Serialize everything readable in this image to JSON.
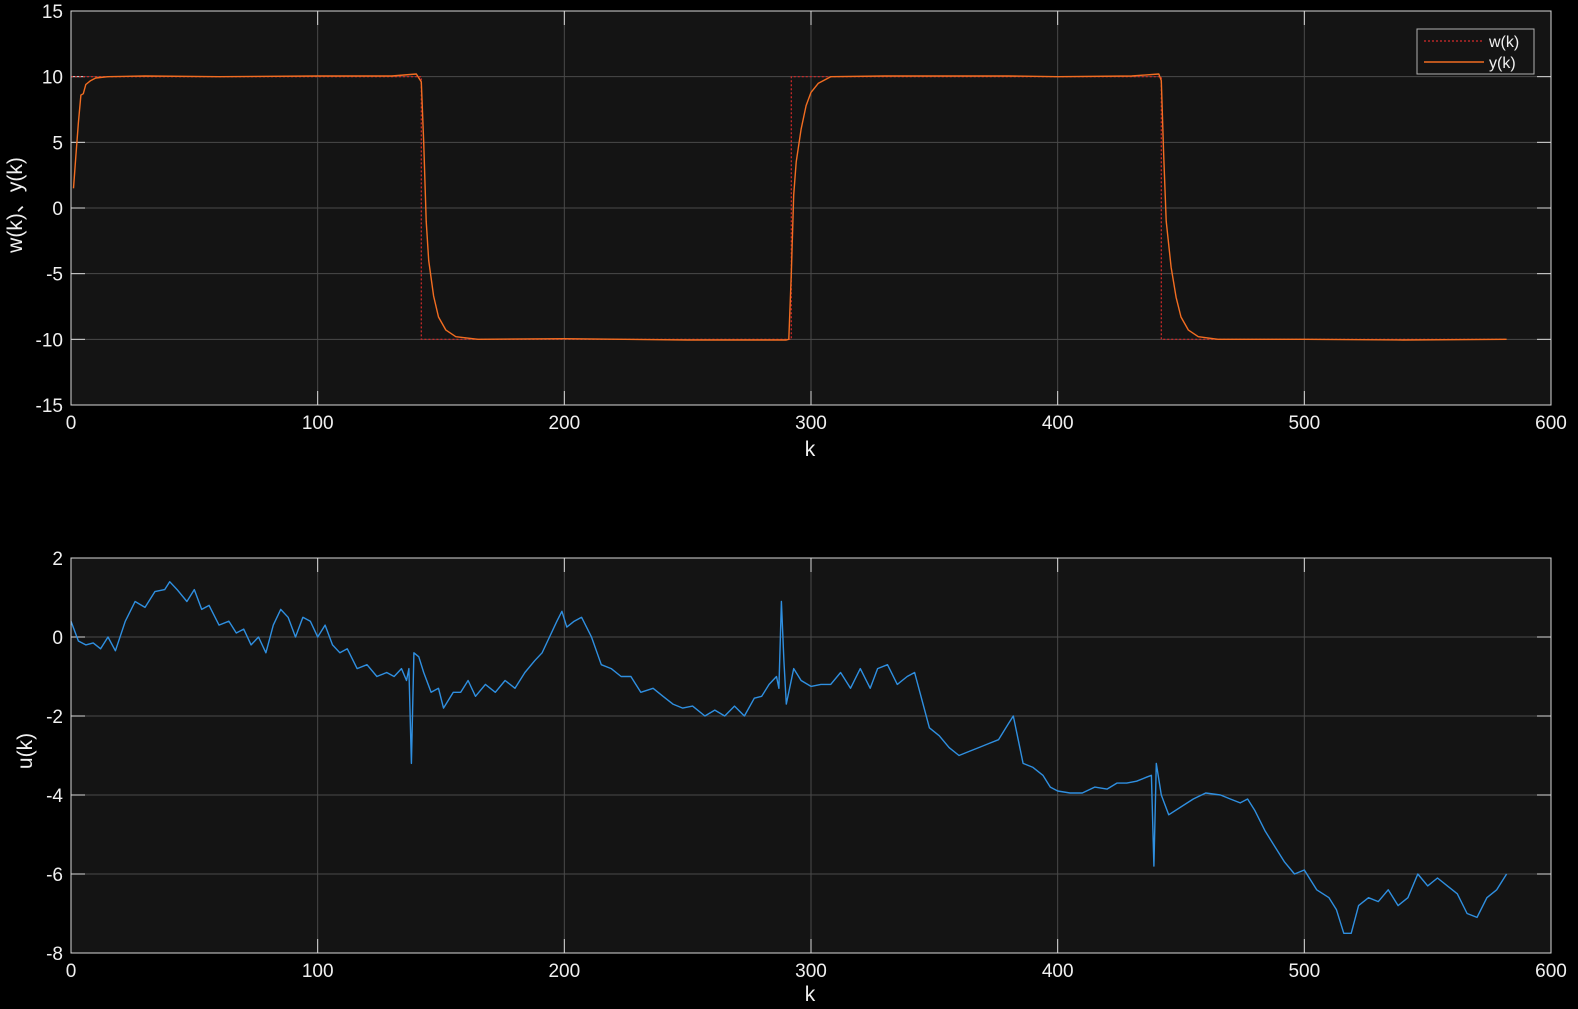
{
  "chart_data": [
    {
      "type": "line",
      "xlabel": "k",
      "ylabel": "w(k)、y(k)",
      "xlim": [
        0,
        600
      ],
      "ylim": [
        -15,
        15
      ],
      "xticks": [
        "0",
        "100",
        "200",
        "300",
        "400",
        "500",
        "600"
      ],
      "yticks": [
        "15",
        "10",
        "5",
        "0",
        "-5",
        "-10",
        "-15"
      ],
      "grid": true,
      "background": "#141414",
      "legend_position": "top-right",
      "series": [
        {
          "name": "w(k)",
          "color": "#d42a2a",
          "line_style": "dotted",
          "points": [
            [
              0,
              10
            ],
            [
              142,
              10
            ],
            [
              142,
              -10
            ],
            [
              292,
              -10
            ],
            [
              292,
              10
            ],
            [
              442,
              10
            ],
            [
              442,
              -10
            ],
            [
              582,
              -10
            ]
          ]
        },
        {
          "name": "y(k)",
          "color": "#f26d21",
          "line_style": "solid",
          "points": [
            [
              1,
              1.5
            ],
            [
              2,
              4
            ],
            [
              3,
              6.5
            ],
            [
              4,
              8.6
            ],
            [
              5,
              8.7
            ],
            [
              6,
              9.4
            ],
            [
              8,
              9.7
            ],
            [
              10,
              9.9
            ],
            [
              15,
              10.0
            ],
            [
              30,
              10.05
            ],
            [
              60,
              10.0
            ],
            [
              100,
              10.05
            ],
            [
              130,
              10.05
            ],
            [
              140,
              10.2
            ],
            [
              142,
              9.6
            ],
            [
              143,
              5
            ],
            [
              144,
              -1
            ],
            [
              145,
              -4
            ],
            [
              147,
              -6.7
            ],
            [
              149,
              -8.3
            ],
            [
              152,
              -9.3
            ],
            [
              156,
              -9.8
            ],
            [
              165,
              -10.0
            ],
            [
              200,
              -9.95
            ],
            [
              250,
              -10.05
            ],
            [
              290,
              -10.05
            ],
            [
              291,
              -10.0
            ],
            [
              292,
              -5
            ],
            [
              293,
              1
            ],
            [
              294,
              3.5
            ],
            [
              296,
              6.0
            ],
            [
              298,
              7.8
            ],
            [
              300,
              8.8
            ],
            [
              303,
              9.5
            ],
            [
              308,
              10.0
            ],
            [
              330,
              10.05
            ],
            [
              380,
              10.05
            ],
            [
              400,
              10.0
            ],
            [
              430,
              10.05
            ],
            [
              441,
              10.2
            ],
            [
              442,
              9.7
            ],
            [
              443,
              4
            ],
            [
              444,
              -1
            ],
            [
              446,
              -4.5
            ],
            [
              448,
              -6.8
            ],
            [
              450,
              -8.3
            ],
            [
              453,
              -9.3
            ],
            [
              457,
              -9.8
            ],
            [
              465,
              -10.0
            ],
            [
              500,
              -10.0
            ],
            [
              540,
              -10.05
            ],
            [
              582,
              -10.0
            ]
          ]
        }
      ]
    },
    {
      "type": "line",
      "xlabel": "k",
      "ylabel": "u(k)",
      "xlim": [
        0,
        600
      ],
      "ylim": [
        -8,
        2
      ],
      "xticks": [
        "0",
        "100",
        "200",
        "300",
        "400",
        "500",
        "600"
      ],
      "yticks": [
        "2",
        "0",
        "-2",
        "-4",
        "-6",
        "-8"
      ],
      "grid": true,
      "background": "#141414",
      "series": [
        {
          "color": "#2f8fe0",
          "line_style": "solid",
          "points": [
            [
              0,
              0.4
            ],
            [
              3,
              -0.1
            ],
            [
              6,
              -0.2
            ],
            [
              9,
              -0.15
            ],
            [
              12,
              -0.3
            ],
            [
              15,
              0.0
            ],
            [
              18,
              -0.35
            ],
            [
              22,
              0.4
            ],
            [
              26,
              0.9
            ],
            [
              30,
              0.75
            ],
            [
              34,
              1.15
            ],
            [
              38,
              1.2
            ],
            [
              40,
              1.4
            ],
            [
              43,
              1.2
            ],
            [
              47,
              0.9
            ],
            [
              50,
              1.2
            ],
            [
              53,
              0.7
            ],
            [
              56,
              0.8
            ],
            [
              60,
              0.3
            ],
            [
              64,
              0.4
            ],
            [
              67,
              0.1
            ],
            [
              70,
              0.2
            ],
            [
              73,
              -0.2
            ],
            [
              76,
              0.0
            ],
            [
              79,
              -0.4
            ],
            [
              82,
              0.3
            ],
            [
              85,
              0.7
            ],
            [
              88,
              0.5
            ],
            [
              91,
              0.0
            ],
            [
              94,
              0.5
            ],
            [
              97,
              0.4
            ],
            [
              100,
              0.0
            ],
            [
              103,
              0.3
            ],
            [
              106,
              -0.2
            ],
            [
              109,
              -0.4
            ],
            [
              112,
              -0.3
            ],
            [
              116,
              -0.8
            ],
            [
              120,
              -0.7
            ],
            [
              124,
              -1.0
            ],
            [
              128,
              -0.9
            ],
            [
              131,
              -1.0
            ],
            [
              134,
              -0.8
            ],
            [
              136,
              -1.1
            ],
            [
              137,
              -0.8
            ],
            [
              138,
              -3.2
            ],
            [
              139,
              -0.4
            ],
            [
              141,
              -0.5
            ],
            [
              143,
              -0.9
            ],
            [
              146,
              -1.4
            ],
            [
              149,
              -1.3
            ],
            [
              151,
              -1.8
            ],
            [
              155,
              -1.4
            ],
            [
              158,
              -1.4
            ],
            [
              161,
              -1.1
            ],
            [
              164,
              -1.5
            ],
            [
              168,
              -1.2
            ],
            [
              172,
              -1.4
            ],
            [
              176,
              -1.1
            ],
            [
              180,
              -1.3
            ],
            [
              184,
              -0.9
            ],
            [
              188,
              -0.6
            ],
            [
              191,
              -0.4
            ],
            [
              194,
              0.0
            ],
            [
              197,
              0.4
            ],
            [
              199,
              0.65
            ],
            [
              201,
              0.25
            ],
            [
              204,
              0.4
            ],
            [
              207,
              0.5
            ],
            [
              211,
              0.0
            ],
            [
              215,
              -0.7
            ],
            [
              219,
              -0.8
            ],
            [
              223,
              -1.0
            ],
            [
              227,
              -1.0
            ],
            [
              231,
              -1.4
            ],
            [
              236,
              -1.3
            ],
            [
              240,
              -1.5
            ],
            [
              244,
              -1.7
            ],
            [
              248,
              -1.8
            ],
            [
              252,
              -1.75
            ],
            [
              257,
              -2.0
            ],
            [
              261,
              -1.85
            ],
            [
              265,
              -2.0
            ],
            [
              269,
              -1.75
            ],
            [
              273,
              -2.0
            ],
            [
              277,
              -1.55
            ],
            [
              280,
              -1.5
            ],
            [
              283,
              -1.2
            ],
            [
              286,
              -1.0
            ],
            [
              287,
              -1.3
            ],
            [
              288,
              0.9
            ],
            [
              289,
              -0.6
            ],
            [
              290,
              -1.7
            ],
            [
              293,
              -0.8
            ],
            [
              296,
              -1.1
            ],
            [
              300,
              -1.25
            ],
            [
              304,
              -1.2
            ],
            [
              308,
              -1.2
            ],
            [
              312,
              -0.9
            ],
            [
              316,
              -1.3
            ],
            [
              320,
              -0.8
            ],
            [
              324,
              -1.3
            ],
            [
              327,
              -0.8
            ],
            [
              331,
              -0.7
            ],
            [
              335,
              -1.2
            ],
            [
              339,
              -1.0
            ],
            [
              342,
              -0.9
            ],
            [
              345,
              -1.6
            ],
            [
              348,
              -2.3
            ],
            [
              352,
              -2.5
            ],
            [
              356,
              -2.8
            ],
            [
              360,
              -3.0
            ],
            [
              364,
              -2.9
            ],
            [
              368,
              -2.8
            ],
            [
              372,
              -2.7
            ],
            [
              376,
              -2.6
            ],
            [
              380,
              -2.2
            ],
            [
              382,
              -2.0
            ],
            [
              384,
              -2.6
            ],
            [
              386,
              -3.2
            ],
            [
              390,
              -3.3
            ],
            [
              394,
              -3.5
            ],
            [
              397,
              -3.8
            ],
            [
              400,
              -3.9
            ],
            [
              405,
              -3.95
            ],
            [
              410,
              -3.95
            ],
            [
              415,
              -3.8
            ],
            [
              420,
              -3.85
            ],
            [
              424,
              -3.7
            ],
            [
              428,
              -3.7
            ],
            [
              432,
              -3.65
            ],
            [
              436,
              -3.55
            ],
            [
              438,
              -3.5
            ],
            [
              439,
              -5.8
            ],
            [
              440,
              -3.2
            ],
            [
              442,
              -4.0
            ],
            [
              445,
              -4.5
            ],
            [
              450,
              -4.3
            ],
            [
              455,
              -4.1
            ],
            [
              460,
              -3.95
            ],
            [
              466,
              -4.0
            ],
            [
              470,
              -4.1
            ],
            [
              474,
              -4.2
            ],
            [
              477,
              -4.1
            ],
            [
              480,
              -4.4
            ],
            [
              484,
              -4.9
            ],
            [
              488,
              -5.3
            ],
            [
              492,
              -5.7
            ],
            [
              496,
              -6.0
            ],
            [
              500,
              -5.9
            ],
            [
              505,
              -6.4
            ],
            [
              510,
              -6.6
            ],
            [
              513,
              -6.9
            ],
            [
              516,
              -7.5
            ],
            [
              519,
              -7.5
            ],
            [
              522,
              -6.8
            ],
            [
              526,
              -6.6
            ],
            [
              530,
              -6.7
            ],
            [
              534,
              -6.4
            ],
            [
              538,
              -6.8
            ],
            [
              542,
              -6.6
            ],
            [
              546,
              -6.0
            ],
            [
              550,
              -6.3
            ],
            [
              554,
              -6.1
            ],
            [
              558,
              -6.3
            ],
            [
              562,
              -6.5
            ],
            [
              566,
              -7.0
            ],
            [
              570,
              -7.1
            ],
            [
              574,
              -6.6
            ],
            [
              578,
              -6.4
            ],
            [
              582,
              -6.0
            ]
          ]
        }
      ]
    }
  ]
}
